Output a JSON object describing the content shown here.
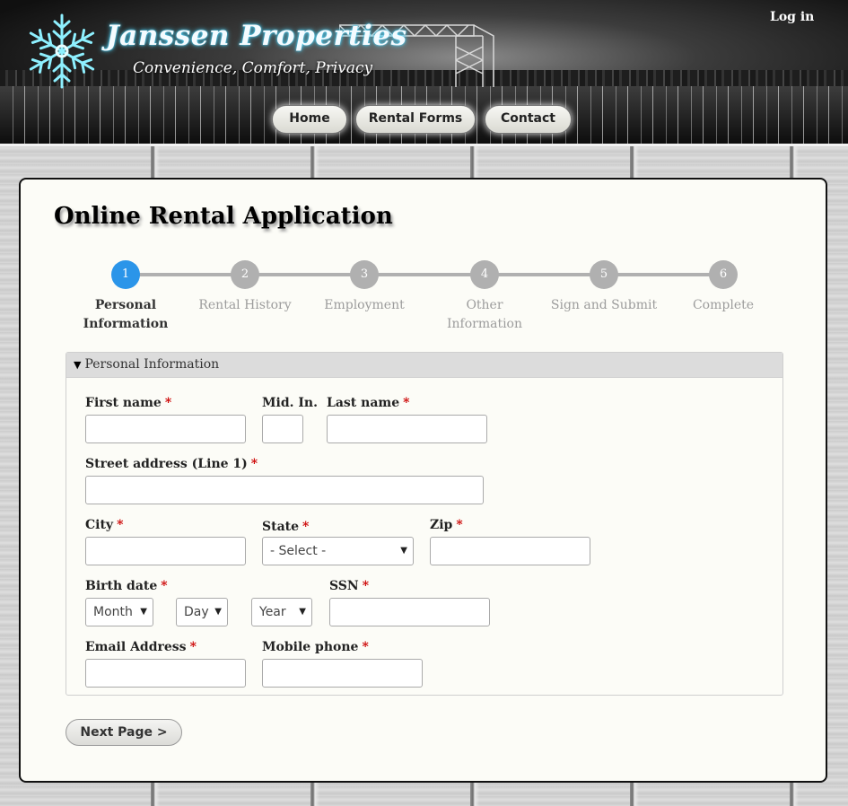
{
  "header": {
    "brand_name": "Janssen Properties",
    "tagline": "Convenience, Comfort, Privacy",
    "login_label": "Log in",
    "nav": [
      {
        "label": "Home"
      },
      {
        "label": "Rental Forms"
      },
      {
        "label": "Contact"
      }
    ],
    "logo_icon": "snowflake-icon"
  },
  "page": {
    "title": "Online Rental Application"
  },
  "progress": {
    "current_step": 1,
    "steps": [
      {
        "number": "1",
        "label_line1": "Personal",
        "label_line2": "Information"
      },
      {
        "number": "2",
        "label_line1": "Rental History",
        "label_line2": ""
      },
      {
        "number": "3",
        "label_line1": "Employment",
        "label_line2": ""
      },
      {
        "number": "4",
        "label_line1": "Other Information",
        "label_line2": ""
      },
      {
        "number": "5",
        "label_line1": "Sign and Submit",
        "label_line2": ""
      },
      {
        "number": "6",
        "label_line1": "Complete",
        "label_line2": ""
      }
    ],
    "active_color": "#2b95e9",
    "inactive_color": "#b0b0b0"
  },
  "form": {
    "section_title": "Personal Information",
    "required_marker": "*",
    "fields": {
      "first_name": {
        "label": "First name",
        "value": ""
      },
      "mid_in": {
        "label": "Mid. In.",
        "value": ""
      },
      "last_name": {
        "label": "Last name",
        "value": ""
      },
      "street_address": {
        "label": "Street address (Line 1)",
        "value": ""
      },
      "city": {
        "label": "City",
        "value": ""
      },
      "state": {
        "label": "State",
        "selected": "- Select -"
      },
      "zip": {
        "label": "Zip",
        "value": ""
      },
      "birth_date": {
        "label": "Birth date",
        "month": "Month",
        "day": "Day",
        "year": "Year"
      },
      "ssn": {
        "label": "SSN",
        "value": ""
      },
      "email": {
        "label": "Email Address",
        "value": ""
      },
      "mobile_phone": {
        "label": "Mobile phone",
        "value": ""
      }
    },
    "next_label": "Next Page >"
  },
  "colors": {
    "required": "#cc0000",
    "card_background": "#fcfcf7"
  }
}
